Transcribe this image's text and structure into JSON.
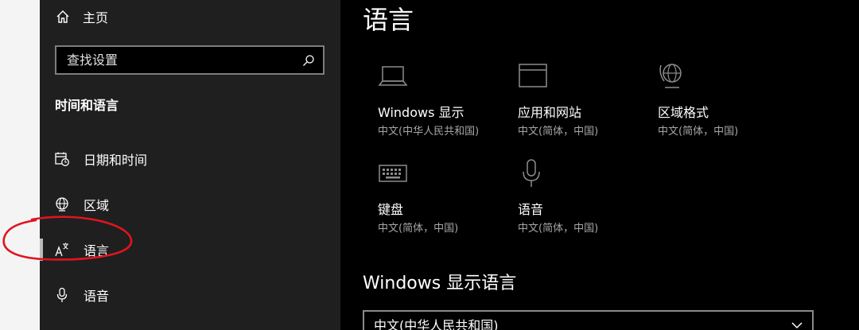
{
  "sidebar": {
    "home_label": "主页",
    "search_placeholder": "查找设置",
    "section_title": "时间和语言",
    "items": [
      {
        "label": "日期和时间",
        "icon": "calendar-clock-icon"
      },
      {
        "label": "区域",
        "icon": "globe-icon"
      },
      {
        "label": "语言",
        "icon": "language-icon",
        "active": true
      },
      {
        "label": "语音",
        "icon": "microphone-icon"
      }
    ]
  },
  "main": {
    "title": "语言",
    "tiles": [
      {
        "name": "Windows 显示",
        "sub": "中文(中华人民共和国)",
        "icon": "laptop-icon"
      },
      {
        "name": "应用和网站",
        "sub": "中文(简体，中国)",
        "icon": "browser-window-icon"
      },
      {
        "name": "区域格式",
        "sub": "中文(简体，中国)",
        "icon": "globe-format-icon"
      },
      {
        "name": "键盘",
        "sub": "中文(简体，中国)",
        "icon": "keyboard-icon"
      },
      {
        "name": "语音",
        "sub": "中文(简体，中国)",
        "icon": "microphone-icon"
      }
    ],
    "display_language_heading": "Windows 显示语言",
    "display_language_value": "中文(中华人民共和国)"
  },
  "colors": {
    "sidebar_bg": "#1f1f1f",
    "main_bg": "#000000",
    "annotation_red": "#e0141e"
  }
}
